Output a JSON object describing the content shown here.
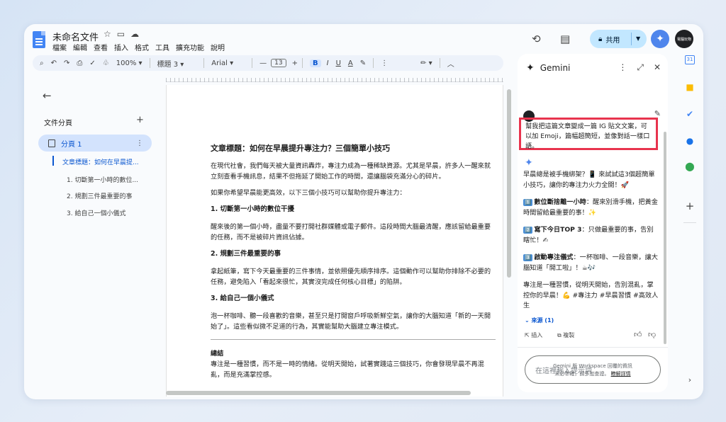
{
  "doc": {
    "title": "未命名文件",
    "menu": [
      "檔案",
      "編輯",
      "查看",
      "插入",
      "格式",
      "工具",
      "擴充功能",
      "說明"
    ]
  },
  "header": {
    "share_label": "共用",
    "avatar_text": "電腦玩物"
  },
  "toolbar": {
    "zoom": "100%",
    "style": "標題 3",
    "font": "Arial",
    "font_size": "13",
    "bold": "B",
    "italic": "I",
    "underline": "U",
    "text_color": "A",
    "minus": "—",
    "plus": "+"
  },
  "sidebar": {
    "title": "文件分頁",
    "tab_label": "分頁 1",
    "outline": [
      "文章標題：如何在早晨提...",
      "1. 切斷第一小時的數位...",
      "2. 規劃三件最重要的事",
      "3. 給自己一個小儀式"
    ]
  },
  "document": {
    "title": "文章標題：如何在早晨提升專注力？三個簡單小技巧",
    "intro": "在現代社會，我們每天被大量資訊轟炸，專注力成為一種稀缺資源。尤其是早晨，許多人一醒來就立刻查看手機訊息，結果不但拖延了開始工作的時間，還讓腦袋充滿分心的碎片。",
    "lead": "如果你希望早晨能更高效，以下三個小技巧可以幫助你提升專注力：",
    "tips": [
      {
        "heading": "1. 切斷第一小時的數位干擾",
        "body": "醒來後的第一個小時，盡量不要打開社群媒體或電子郵件。這段時間大腦最清醒，應該留給最重要的任務，而不是被碎片資訊佔據。"
      },
      {
        "heading": "2. 規劃三件最重要的事",
        "body": "拿起紙筆，寫下今天最重要的三件事情，並依照優先順序排序。這個動作可以幫助你排除不必要的任務，避免陷入「看起來很忙，其實沒完成任何核心目標」的陷阱。"
      },
      {
        "heading": "3. 給自己一個小儀式",
        "body": "泡一杯咖啡、聽一段喜歡的音樂，甚至只是打開窗戶呼吸新鮮空氣，讓你的大腦知道「新的一天開始了」。這些看似微不足道的行為，其實能幫助大腦建立專注模式。"
      }
    ],
    "summary_heading": "總結",
    "summary": "專注是一種習慣，而不是一時的情緒。從明天開始，試著實踐這三個技巧，你會發現早晨不再混亂，而是充滿掌控感。"
  },
  "gemini": {
    "title": "Gemini",
    "prompt": "幫我把這篇文章變成一篇 IG 貼文文案，可以加 Emoji，篇幅超簡短，並像對話一樣口語。",
    "response": {
      "intro": "早晨總是被手機綁架？📱 來試試這3個超簡單小技巧，讓你的專注力火力全開！🚀",
      "item1_num": "1️⃣",
      "item1_bold": "數位斷捨離一小時",
      "item1_rest": "：醒來別滑手機，把黃金時間留給最重要的事！✨",
      "item2_num": "2️⃣",
      "item2_bold": "寫下今日TOP 3",
      "item2_rest": "：只做最重要的事，告別瞎忙！✍",
      "item3_num": "3️⃣",
      "item3_bold": "啟動專注儀式",
      "item3_rest": "：一杯咖啡、一段音樂，讓大腦知道「開工啦」！☕🎶",
      "outro": "專注是一種習慣，從明天開始，告別混亂，掌控你的早晨！💪 #專注力 #早晨習慣 #高效人生"
    },
    "sources": "來源 (1)",
    "insert_label": "插入",
    "copy_label": "複製",
    "input_placeholder": "在這裡輸入提示詞",
    "footer_line1": "Gemini 版 Workspace 回覆的資訊",
    "footer_line2": "未必準確，請多加查證。",
    "footer_link": "瞭解詳情"
  },
  "rail": {
    "calendar_day": "31"
  },
  "colors": {
    "accent": "#0b57d0",
    "share_bg": "#c2e7ff",
    "highlight_border": "#e8344e"
  }
}
